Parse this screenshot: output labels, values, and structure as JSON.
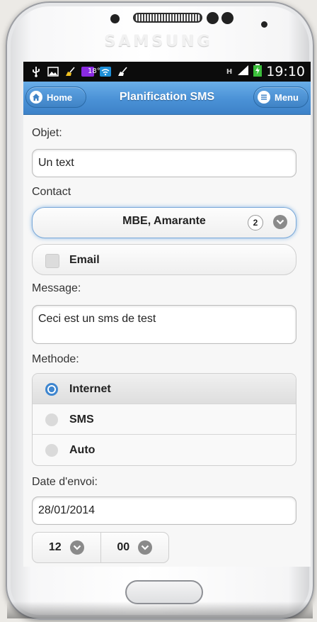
{
  "device": {
    "brand": "SAMSUNG"
  },
  "status_bar": {
    "time": "19:10",
    "temperature": "18°",
    "network_type": "H",
    "icons": [
      "usb-icon",
      "image-icon",
      "broom-icon",
      "temperature-icon",
      "wifi-icon",
      "broom-icon"
    ]
  },
  "header": {
    "title": "Planification SMS",
    "home_label": "Home",
    "menu_label": "Menu",
    "accent_color": "#4a91d6"
  },
  "form": {
    "subject_label": "Objet:",
    "subject_value": "Un text",
    "contact_label": "Contact",
    "contact_selected": "MBE, Amarante",
    "contact_count": "2",
    "email_label": "Email",
    "email_checked": false,
    "message_label": "Message:",
    "message_value": "Ceci est un sms de test",
    "method_label": "Methode:",
    "methods": [
      {
        "label": "Internet",
        "selected": true
      },
      {
        "label": "SMS",
        "selected": false
      },
      {
        "label": "Auto",
        "selected": false
      }
    ],
    "date_label": "Date d'envoi:",
    "date_value": "28/01/2014",
    "hour_value": "12",
    "minute_value": "00"
  }
}
